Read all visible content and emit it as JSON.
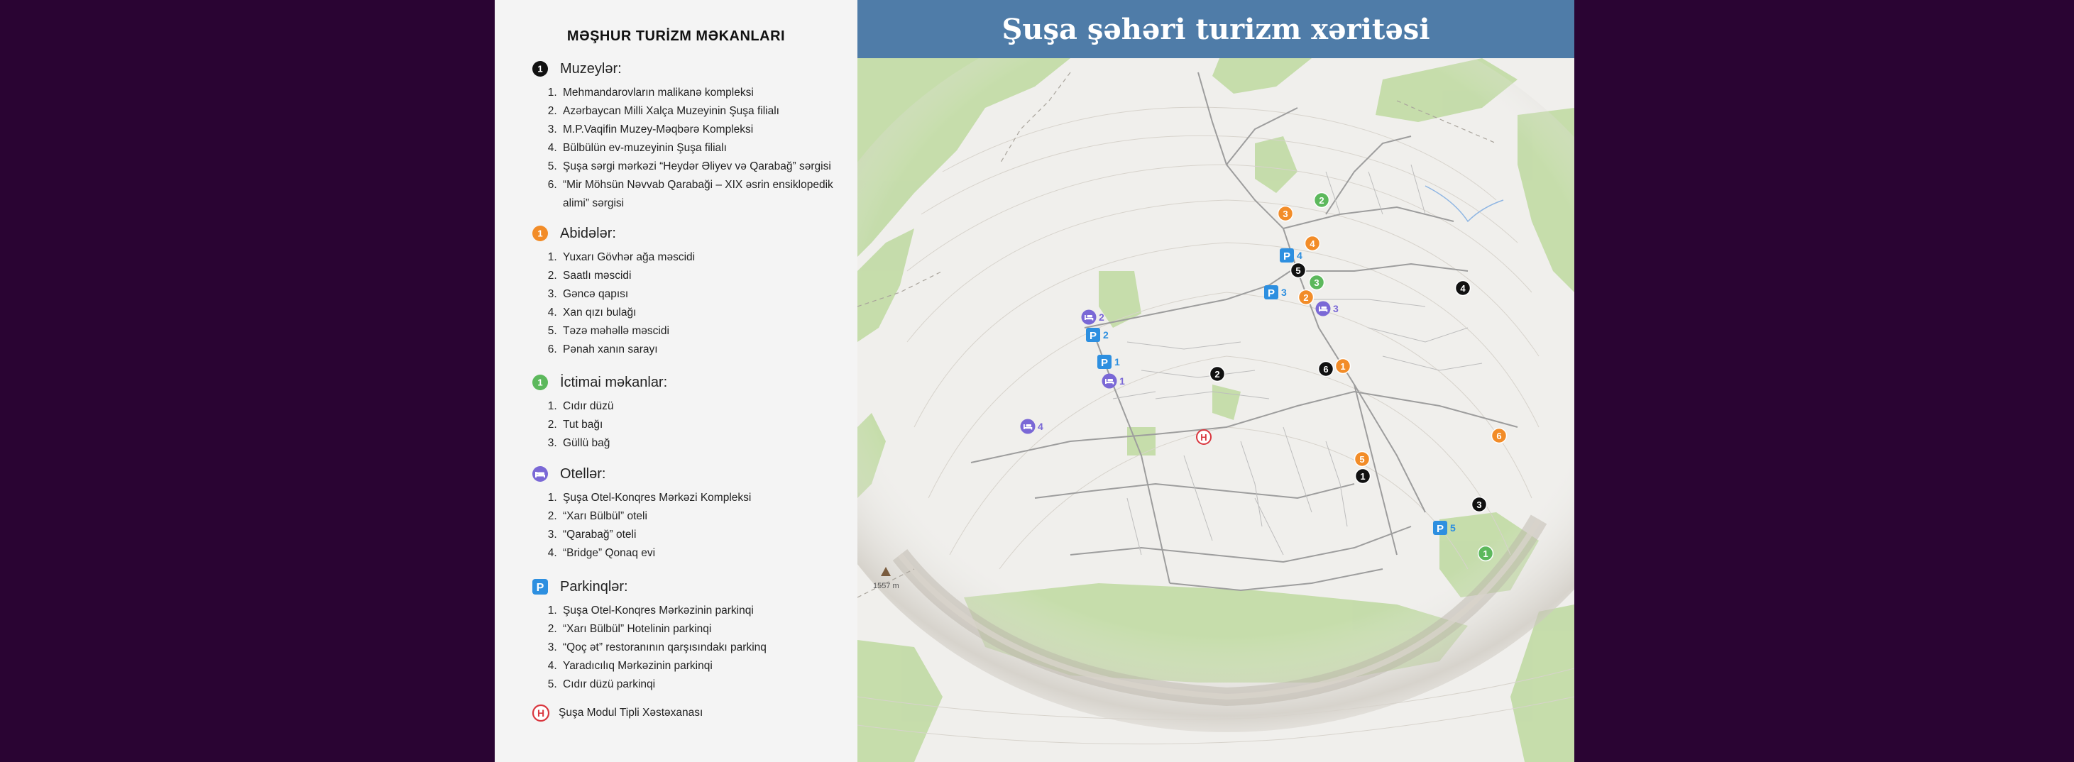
{
  "legend": {
    "title": "MƏŞHUR TURİZM MƏKANLARI",
    "museums": {
      "label": "Muzeylər:",
      "items": [
        "Mehmandarovların malikanə kompleksi",
        "Azərbaycan Milli Xalça Muzeyinin Şuşa filialı",
        "M.P.Vaqifin Muzey-Məqbərə Kompleksi",
        "Bülbülün ev-muzeyinin Şuşa filialı",
        "Şuşa sərgi mərkəzi “Heydər Əliyev və Qarabağ” sərgisi",
        "“Mir Möhsün Nəvvab Qarabaği – XIX əsrin ensiklopedik alimi” sərgisi"
      ]
    },
    "monuments": {
      "label": "Abidələr:",
      "items": [
        "Yuxarı Gövhər ağa məscidi",
        "Saatlı məscidi",
        "Gəncə qapısı",
        "Xan qızı bulağı",
        "Təzə məhəllə məscidi",
        "Pənah xanın sarayı"
      ]
    },
    "public": {
      "label": "İctimai məkanlar:",
      "items": [
        "Cıdır düzü",
        "Tut bağı",
        "Güllü bağ"
      ]
    },
    "hotels": {
      "label": "Otellər:",
      "items": [
        "Şuşa Otel-Konqres Mərkəzi Kompleksi",
        "“Xarı Bülbül” oteli",
        "“Qarabağ” oteli",
        "“Bridge” Qonaq evi"
      ]
    },
    "parking": {
      "label": "Parkinqlər:",
      "items": [
        "Şuşa Otel-Konqres Mərkəzinin parkinqi",
        "“Xarı Bülbül” Hotelinin parkinqi",
        "“Qoç ət” restoranının qarşısındakı parkinq",
        "Yaradıcılıq Mərkəzinin parkinqi",
        "Cıdır düzü parkinqi"
      ]
    },
    "hospital": {
      "label": "Şuşa Modul Tipli Xəstəxanası",
      "glyph": "H"
    },
    "legend_numbers": {
      "museum": "1",
      "monument": "1",
      "public": "1"
    },
    "parking_glyph": "P"
  },
  "map": {
    "title": "Şuşa şəhəri turizm xəritəsi",
    "peak_label": "1557 m",
    "markers": {
      "museums": [
        "1",
        "2",
        "3",
        "4",
        "5",
        "6"
      ],
      "monuments": [
        "1",
        "2",
        "3",
        "4",
        "5",
        "6"
      ],
      "public": [
        "1",
        "2",
        "3"
      ],
      "hotels": [
        "1",
        "2",
        "3",
        "4"
      ],
      "parking": [
        "1",
        "2",
        "3",
        "4",
        "5"
      ]
    }
  },
  "colors": {
    "museum": "#111111",
    "monument": "#f28c28",
    "public": "#5cb85c",
    "hotel": "#7a68d6",
    "parking": "#2d8fe0",
    "hospital": "#d9363e",
    "header": "#4f7ca8",
    "background": "#2a0433"
  }
}
